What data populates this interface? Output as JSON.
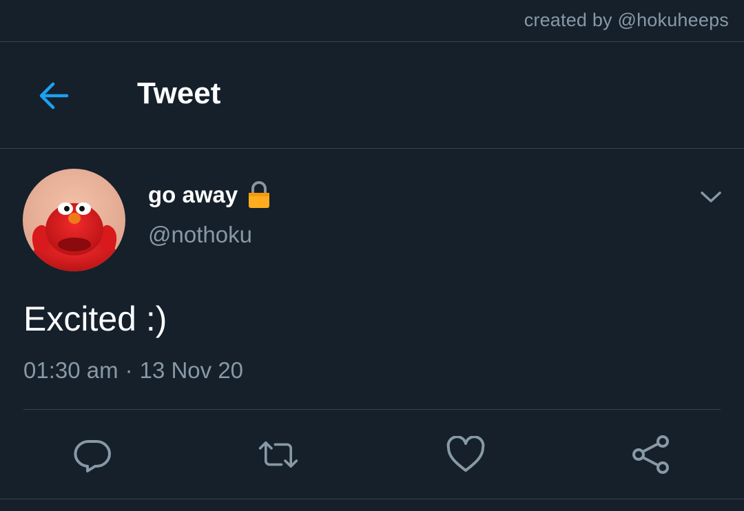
{
  "watermark": "created by @hokuheeps",
  "header": {
    "title": "Tweet",
    "back_icon": "arrow-left-icon"
  },
  "tweet": {
    "display_name": "go away",
    "lock_icon": "lock-icon",
    "handle": "@nothoku",
    "text": "Excited :)",
    "time": "01:30 am",
    "separator": "·",
    "date": "13 Nov 20"
  },
  "actions": {
    "reply": "reply-icon",
    "retweet": "retweet-icon",
    "like": "heart-icon",
    "share": "share-icon"
  },
  "colors": {
    "background": "#15202b",
    "accent": "#1da1f2",
    "secondary_text": "#8899a6",
    "divider": "#38444d",
    "lock": "#ffad1f"
  }
}
